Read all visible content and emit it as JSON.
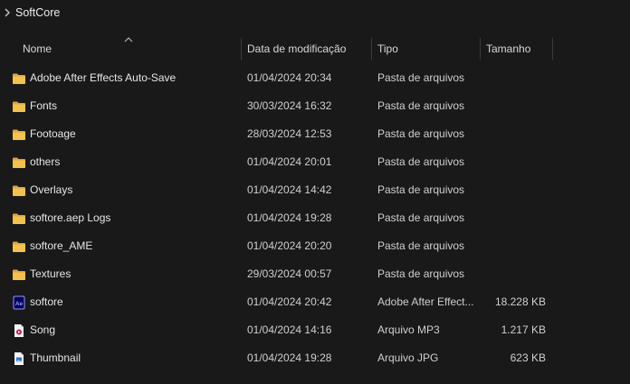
{
  "breadcrumb": {
    "folder": "SoftCore"
  },
  "columns": {
    "name": "Nome",
    "modified": "Data de modificação",
    "type": "Tipo",
    "size": "Tamanho"
  },
  "sort": {
    "column": "name",
    "direction": "ascending"
  },
  "colors": {
    "folder": "#f2c14e",
    "folder_dark": "#d9a93a",
    "ae": "#9999ff",
    "ae_bg": "#00005b"
  },
  "files": [
    {
      "icon": "folder-icon",
      "name": "Adobe After Effects Auto-Save",
      "modified": "01/04/2024 20:34",
      "type": "Pasta de arquivos",
      "size": ""
    },
    {
      "icon": "folder-icon",
      "name": "Fonts",
      "modified": "30/03/2024 16:32",
      "type": "Pasta de arquivos",
      "size": ""
    },
    {
      "icon": "folder-icon",
      "name": "Footoage",
      "modified": "28/03/2024 12:53",
      "type": "Pasta de arquivos",
      "size": ""
    },
    {
      "icon": "folder-icon",
      "name": "others",
      "modified": "01/04/2024 20:01",
      "type": "Pasta de arquivos",
      "size": ""
    },
    {
      "icon": "folder-icon",
      "name": "Overlays",
      "modified": "01/04/2024 14:42",
      "type": "Pasta de arquivos",
      "size": ""
    },
    {
      "icon": "folder-icon",
      "name": "softore.aep Logs",
      "modified": "01/04/2024 19:28",
      "type": "Pasta de arquivos",
      "size": ""
    },
    {
      "icon": "folder-icon",
      "name": "softore_AME",
      "modified": "01/04/2024 20:20",
      "type": "Pasta de arquivos",
      "size": ""
    },
    {
      "icon": "folder-icon",
      "name": "Textures",
      "modified": "29/03/2024 00:57",
      "type": "Pasta de arquivos",
      "size": ""
    },
    {
      "icon": "after-effects-file-icon",
      "name": "softore",
      "modified": "01/04/2024 20:42",
      "type": "Adobe After Effect...",
      "size": "18.228 KB"
    },
    {
      "icon": "mp3-file-icon",
      "name": "Song",
      "modified": "01/04/2024 14:16",
      "type": "Arquivo MP3",
      "size": "1.217 KB"
    },
    {
      "icon": "jpg-file-icon",
      "name": "Thumbnail",
      "modified": "01/04/2024 19:28",
      "type": "Arquivo JPG",
      "size": "623 KB"
    }
  ]
}
